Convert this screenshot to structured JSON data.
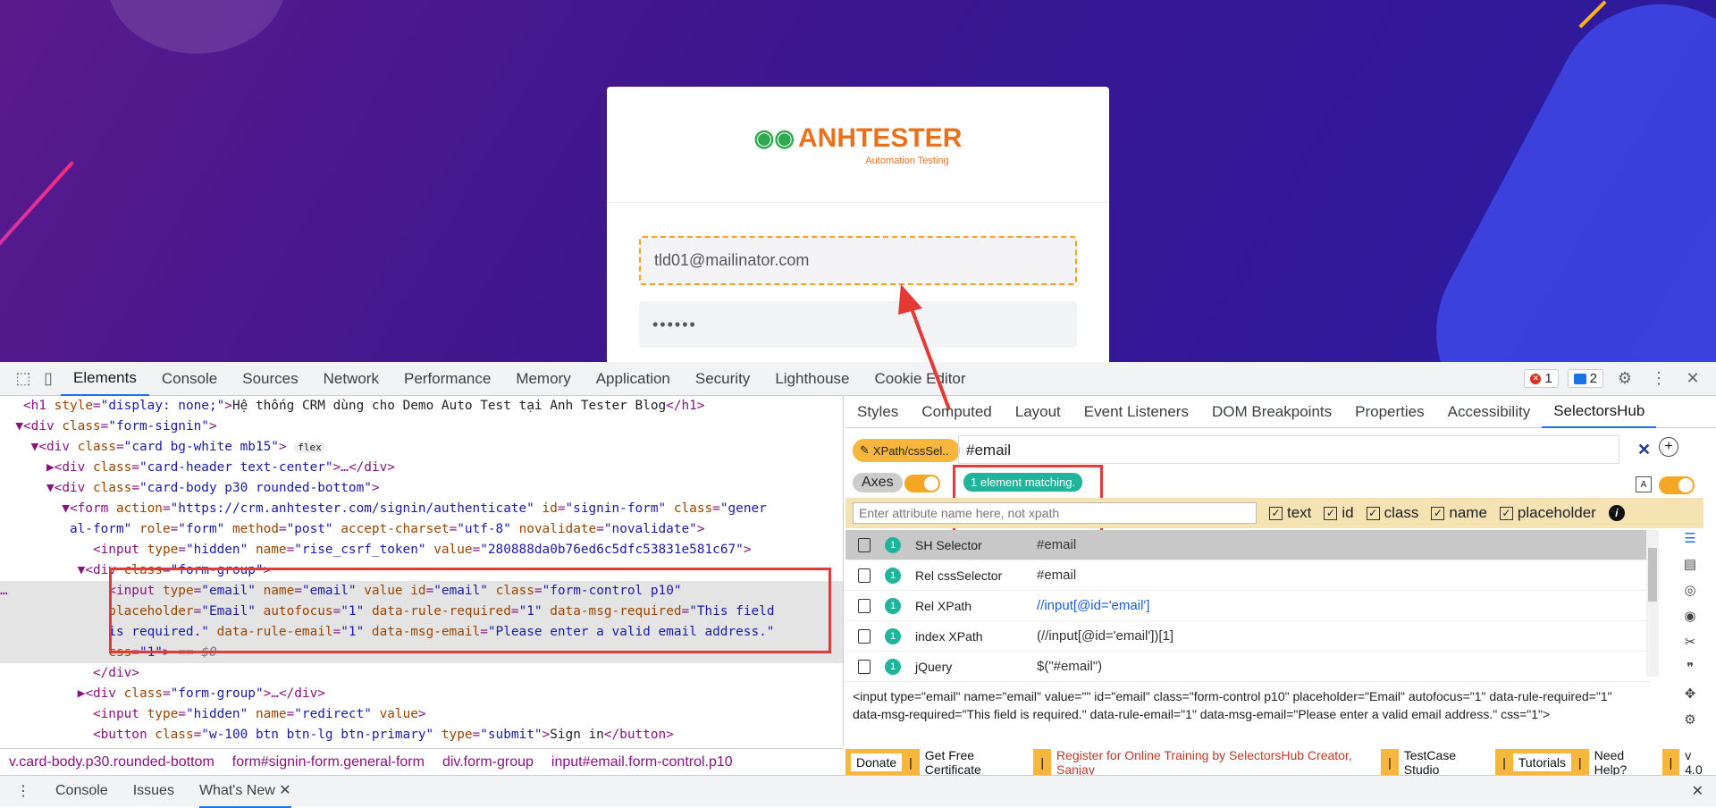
{
  "page": {
    "logo_text": "ANHTESTER",
    "logo_tagline": "Automation Testing",
    "email_value": "tld01@mailinator.com",
    "password_value": "••••••"
  },
  "devtools": {
    "tabs": [
      "Elements",
      "Console",
      "Sources",
      "Network",
      "Performance",
      "Memory",
      "Application",
      "Security",
      "Lighthouse",
      "Cookie Editor"
    ],
    "error_count": "1",
    "message_count": "2",
    "breadcrumbs": [
      "v.card-body.p30.rounded-bottom",
      "form#signin-form.general-form",
      "div.form-group",
      "input#email.form-control.p10"
    ],
    "drawer_tabs": [
      "Console",
      "Issues",
      "What's New"
    ],
    "right_tabs": [
      "Styles",
      "Computed",
      "Layout",
      "Event Listeners",
      "DOM Breakpoints",
      "Properties",
      "Accessibility",
      "SelectorsHub"
    ]
  },
  "selectorshub": {
    "mode_label": "XPath/cssSel..",
    "selector_value": "#email",
    "axes_label": "Axes",
    "match_text": "1 element matching.",
    "attr_placeholder": "Enter attribute name here, not xpath",
    "checkboxes": [
      "text",
      "id",
      "class",
      "name",
      "placeholder"
    ],
    "rows": [
      {
        "count": "1",
        "name": "SH Selector",
        "value": "#email"
      },
      {
        "count": "1",
        "name": "Rel cssSelector",
        "value": "#email"
      },
      {
        "count": "1",
        "name": "Rel XPath",
        "value": "//input[@id='email']"
      },
      {
        "count": "1",
        "name": "index XPath",
        "value": "(//input[@id='email'])[1]"
      },
      {
        "count": "1",
        "name": "jQuery",
        "value": "$(\"#email\")"
      }
    ],
    "snippet": "<input type=\"email\" name=\"email\" value=\"\" id=\"email\" class=\"form-control p10\" placeholder=\"Email\" autofocus=\"1\" data-rule-required=\"1\" data-msg-required=\"This field is required.\" data-rule-email=\"1\" data-msg-email=\"Please enter a valid email address.\" css=\"1\">",
    "footer": [
      "Donate",
      "Get Free Certificate",
      "Register for Online Training by SelectorsHub Creator, Sanjay",
      "TestCase Studio",
      "Tutorials",
      "Need Help?",
      "v 4.0"
    ]
  },
  "colors": {
    "accent": "#1a73e8",
    "highlight": "#e53935",
    "sh_orange": "#f6b73c"
  }
}
